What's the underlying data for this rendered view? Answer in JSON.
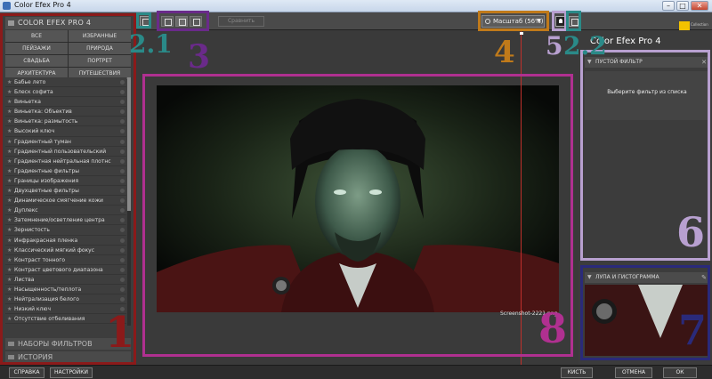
{
  "window": {
    "title": "Color Efex Pro 4",
    "controls": [
      "–",
      "□",
      "✕"
    ]
  },
  "toolbar": {
    "compare_label": "Сравнить",
    "zoom_label": "Масштаб (56%)"
  },
  "left_panel": {
    "header": "COLOR EFEX PRO 4",
    "categories": [
      "ВСЕ",
      "ИЗБРАННЫЕ",
      "ПЕЙЗАЖИ",
      "ПРИРОДА",
      "СВАДЬБА",
      "ПОРТРЕТ",
      "АРХИТЕКТУРА",
      "ПУТЕШЕСТВИЯ"
    ],
    "filters": [
      "Бабье лето",
      "Блеск софита",
      "Виньетка",
      "Виньетка: Объектив",
      "Виньетка: размытость",
      "Высокий ключ",
      "Градиентный туман",
      "Градиентный пользовательский",
      "Градиентная нейтральная плотнс",
      "Градиентные фильтры",
      "Границы изображения",
      "Двухцветные фильтры",
      "Динамическое смягчение кожи",
      "Дуплекс",
      "Затемнение/осветление центра",
      "Зернистость",
      "Инфракрасная пленка",
      "Классический мягкий фокус",
      "Контраст тонного",
      "Контраст цветового диапазона",
      "Листва",
      "Насыщенность/теплота",
      "Нейтрализация белого",
      "Низкий ключ",
      "Отсутствие отбеливания"
    ],
    "section_presets": "НАБОРЫ ФИЛЬТРОВ",
    "section_history": "ИСТОРИЯ"
  },
  "preview": {
    "filename": "Screenshot-2221.png"
  },
  "right_panel": {
    "brand": "Color Efex Pro 4",
    "nik_label": "Collection",
    "filter_header": "ПУСТОЙ ФИЛЬТР",
    "filter_message": "Выберите фильтр из списка",
    "loupe_header": "ЛУПА И ГИСТОГРАММА"
  },
  "bottom": {
    "help": "СПРАВКА",
    "settings": "НАСТРОЙКИ",
    "brush": "КИСТЬ",
    "cancel": "ОТМЕНА",
    "ok": "ОК"
  },
  "annotations": {
    "labels": [
      "1",
      "2.1",
      "3",
      "4",
      "5",
      "2.2",
      "6",
      "7",
      "8"
    ],
    "colors": {
      "maroon": "#8b1a1a",
      "teal": "#2a8a88",
      "purple": "#6a2a8a",
      "orange": "#c07a1a",
      "magenta": "#b03090",
      "lavender": "#b8a0d0",
      "navy": "#2a2a7a"
    }
  }
}
